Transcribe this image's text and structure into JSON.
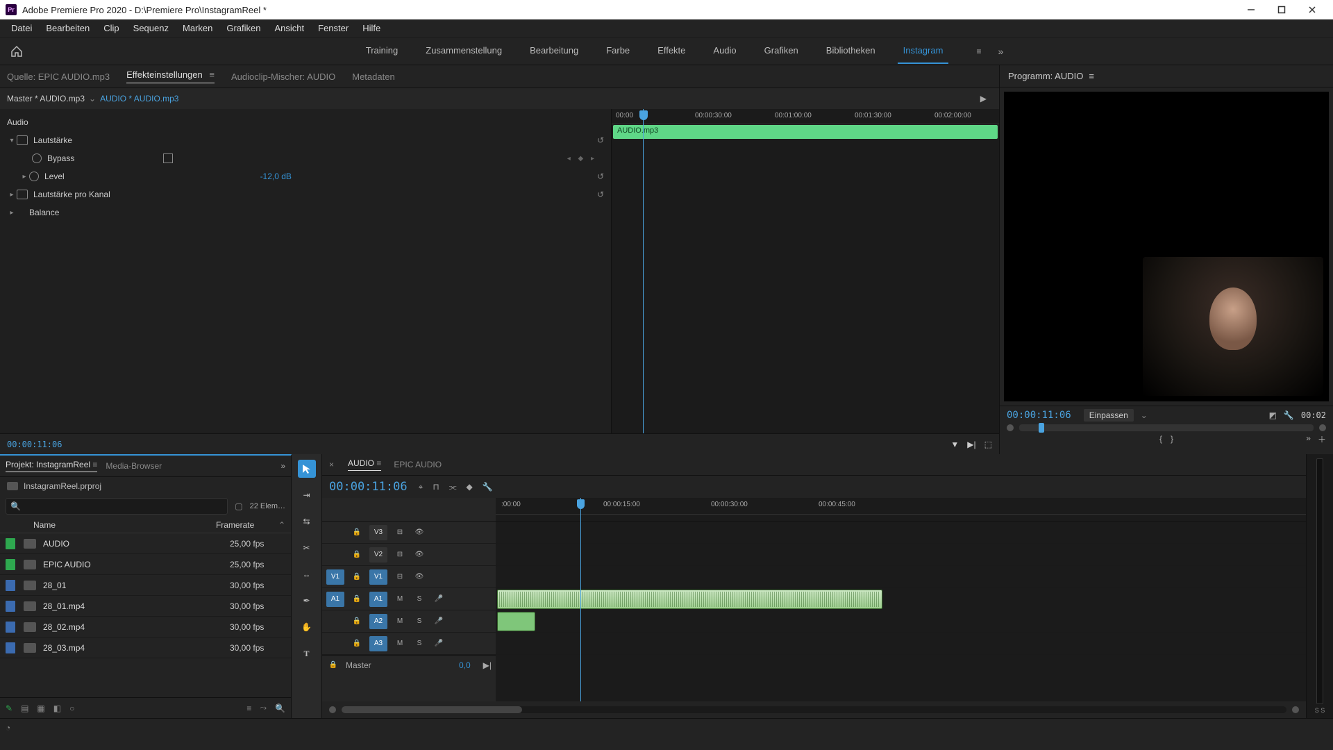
{
  "window": {
    "title": "Adobe Premiere Pro 2020 - D:\\Premiere Pro\\InstagramReel *",
    "icon_label": "Pr"
  },
  "menu": [
    "Datei",
    "Bearbeiten",
    "Clip",
    "Sequenz",
    "Marken",
    "Grafiken",
    "Ansicht",
    "Fenster",
    "Hilfe"
  ],
  "workspaces": {
    "items": [
      "Training",
      "Zusammenstellung",
      "Bearbeitung",
      "Farbe",
      "Effekte",
      "Audio",
      "Grafiken",
      "Bibliotheken",
      "Instagram"
    ],
    "active_index": 8
  },
  "source_tabs": {
    "items": [
      "Quelle: EPIC AUDIO.mp3",
      "Effekteinstellungen",
      "Audioclip-Mischer: AUDIO",
      "Metadaten"
    ],
    "active_index": 1
  },
  "effect_controls": {
    "master": "Master * AUDIO.mp3",
    "clip": "AUDIO * AUDIO.mp3",
    "section": "Audio",
    "rows": {
      "volume": "Lautstärke",
      "bypass": "Bypass",
      "level": "Level",
      "level_value": "-12,0 dB",
      "channel_volume": "Lautstärke pro Kanal",
      "balance": "Balance"
    },
    "ruler": [
      "00:00",
      "00:00:30:00",
      "00:01:00:00",
      "00:01:30:00",
      "00:02:00:00"
    ],
    "clip_label": "AUDIO.mp3",
    "timecode": "00:00:11:06"
  },
  "program": {
    "title": "Programm: AUDIO",
    "timecode": "00:00:11:06",
    "zoom": "Einpassen",
    "duration": "00:02"
  },
  "project": {
    "tabs": [
      "Projekt: InstagramReel",
      "Media-Browser"
    ],
    "active_tab": 0,
    "filename": "InstagramReel.prproj",
    "count": "22 Elem…",
    "columns": {
      "name": "Name",
      "framerate": "Framerate"
    },
    "items": [
      {
        "swatch": "green",
        "name": "AUDIO",
        "fps": "25,00 fps"
      },
      {
        "swatch": "green",
        "name": "EPIC AUDIO",
        "fps": "25,00 fps"
      },
      {
        "swatch": "blue",
        "name": "28_01",
        "fps": "30,00 fps"
      },
      {
        "swatch": "blue",
        "name": "28_01.mp4",
        "fps": "30,00 fps"
      },
      {
        "swatch": "blue",
        "name": "28_02.mp4",
        "fps": "30,00 fps"
      },
      {
        "swatch": "blue",
        "name": "28_03.mp4",
        "fps": "30,00 fps"
      }
    ]
  },
  "timeline": {
    "tabs": [
      "AUDIO",
      "EPIC AUDIO"
    ],
    "active_tab": 0,
    "timecode": "00:00:11:06",
    "ruler": [
      ":00:00",
      "00:00:15:00",
      "00:00:30:00",
      "00:00:45:00"
    ],
    "video_tracks": [
      "V3",
      "V2",
      "V1"
    ],
    "audio_tracks": [
      "A1",
      "A2",
      "A3"
    ],
    "master_label": "Master",
    "master_value": "0,0"
  },
  "meters": {
    "label": "S  S"
  }
}
